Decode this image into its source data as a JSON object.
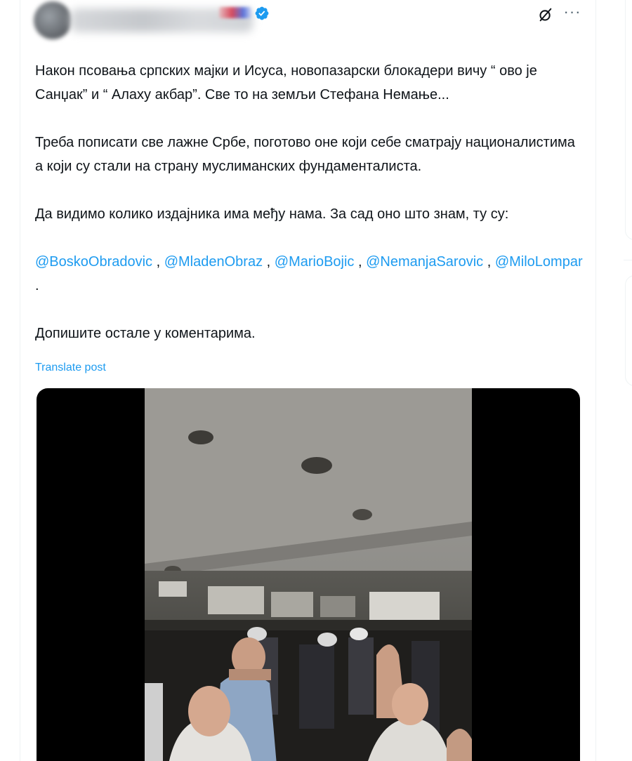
{
  "post": {
    "author": {
      "name_obscured": true,
      "verified_badge_icon": "verified-badge-icon",
      "verified_color": "#1d9bf0"
    },
    "header_icons": {
      "grok": "grok-icon",
      "more": "···"
    },
    "text": {
      "p1": "Након псовања српских мајки и Исуса, новопазарски блокадери вичу “ ово је Санџак” и “ Алаху акбар”. Све то на земљи Стефана Немање...",
      "p2": "Треба пописати све лажне Србе,  поготово оне који себе сматрају националистима а који су стали на страну муслиманских фундаменталиста.",
      "p3": "Да видимо колико издајника има међу нама. За сад оно што знам, ту су:",
      "mentions": [
        "@BoskoObradovic",
        "@MladenObraz",
        "@MarioBojic",
        "@NemanjaSarovic",
        "@MiloLompar"
      ],
      "separator": " , ",
      "mentions_end": " .",
      "p5": "Допишите остале у коментарима."
    },
    "translate_label": "Translate post",
    "media": {
      "type": "video",
      "letterbox_color": "#000000"
    }
  },
  "colors": {
    "link": "#1d9bf0",
    "text": "#0f1419",
    "secondary": "#536471",
    "border": "#eff3f4"
  }
}
